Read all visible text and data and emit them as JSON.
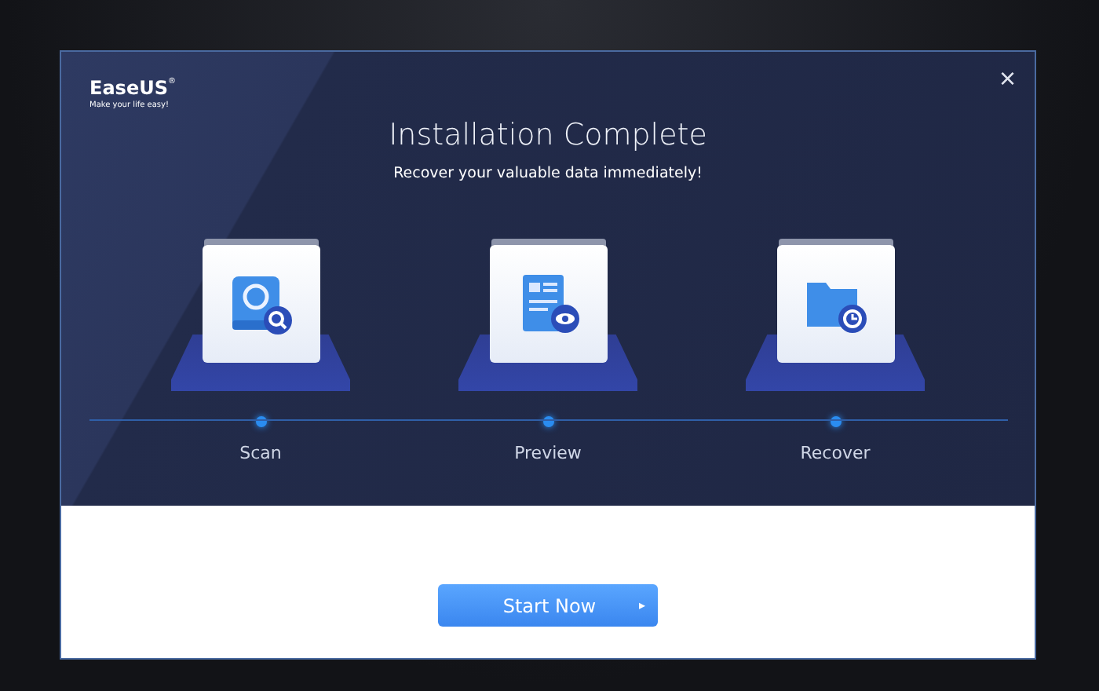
{
  "logo": {
    "brand": "EaseUS",
    "mark": "®",
    "tagline": "Make your life easy!"
  },
  "close_button": {
    "label": "×"
  },
  "title": "Installation Complete",
  "subtitle": "Recover your valuable data immediately!",
  "steps": [
    {
      "kind": "scan",
      "label": "Scan"
    },
    {
      "kind": "preview",
      "label": "Preview"
    },
    {
      "kind": "recover",
      "label": "Recover"
    }
  ],
  "start_button": {
    "label": "Start Now",
    "caret": "▸"
  }
}
